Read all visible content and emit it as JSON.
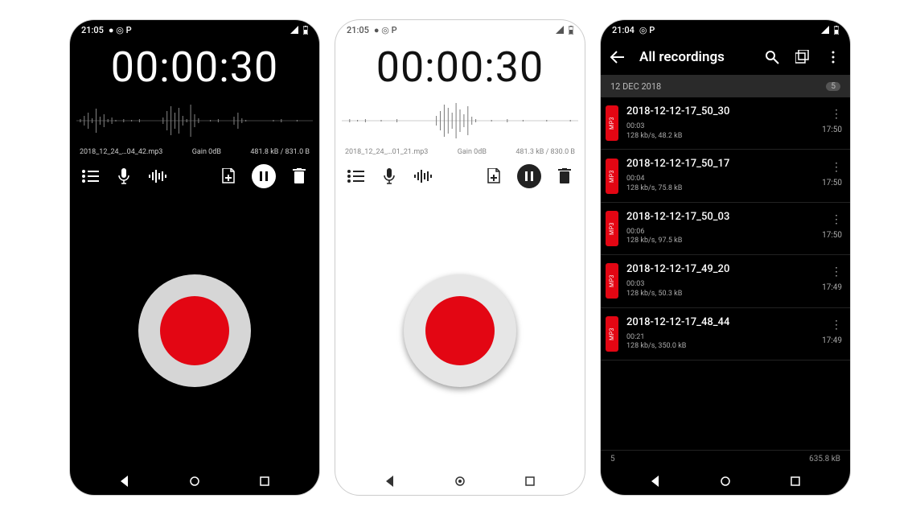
{
  "screens": {
    "rec_dark": {
      "statusbar": {
        "time": "21:05",
        "icons_left": "● ◎ P"
      },
      "timer": "00:00:30",
      "info": {
        "filename": "2018_12_24_…04_42.mp3",
        "gain": "Gain 0dB",
        "size": "481.8 kB / 831.0 B"
      }
    },
    "rec_light": {
      "statusbar": {
        "time": "21:05",
        "icons_left": "● ◎ P"
      },
      "timer": "00:00:30",
      "info": {
        "filename": "2018_12_24_…01_21.mp3",
        "gain": "Gain 0dB",
        "size": "481.3 kB / 830.0 B"
      }
    },
    "list": {
      "statusbar": {
        "time": "21:04",
        "icons_left": "◎ P"
      },
      "title": "All recordings",
      "section": {
        "label": "12 DEC 2018",
        "count": "5"
      },
      "tag_label": "MP3",
      "items": [
        {
          "name": "2018-12-12-17_50_30",
          "meta1": "00:03",
          "meta2": "128 kb/s, 48.2 kB",
          "time": "17:50"
        },
        {
          "name": "2018-12-12-17_50_17",
          "meta1": "00:04",
          "meta2": "128 kb/s, 75.8 kB",
          "time": "17:50"
        },
        {
          "name": "2018-12-12-17_50_03",
          "meta1": "00:06",
          "meta2": "128 kb/s, 97.5 kB",
          "time": "17:50"
        },
        {
          "name": "2018-12-12-17_49_20",
          "meta1": "00:03",
          "meta2": "128 kb/s, 50.3 kB",
          "time": "17:49"
        },
        {
          "name": "2018-12-12-17_48_44",
          "meta1": "00:21",
          "meta2": "128 kb/s, 350.0 kB",
          "time": "17:49"
        }
      ],
      "footer": {
        "count": "5",
        "total": "635.8 kB"
      }
    }
  }
}
